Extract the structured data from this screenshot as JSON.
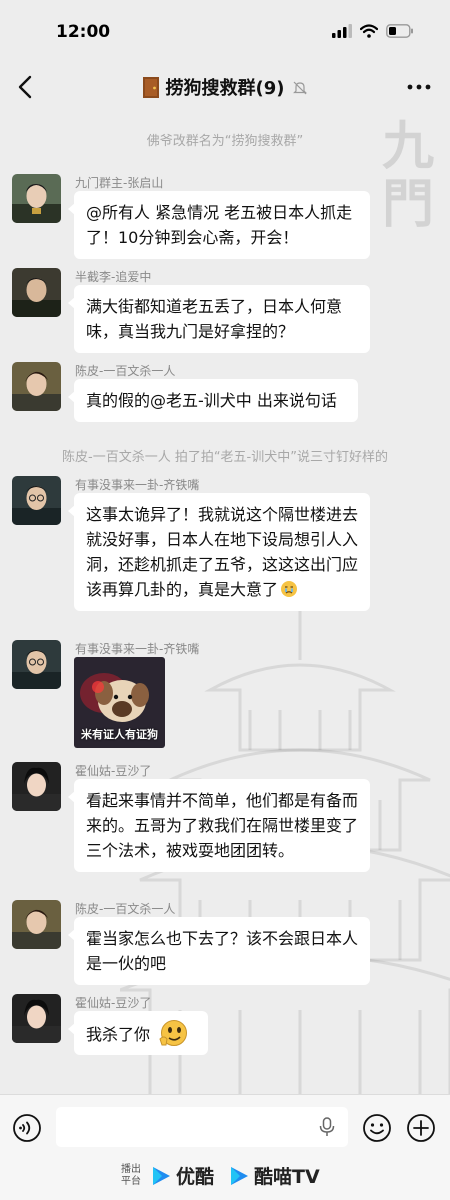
{
  "status": {
    "time": "12:00"
  },
  "header": {
    "title": "捞狗搜救群(9)"
  },
  "system_messages": [
    "佛爷改群名为“捞狗搜救群”",
    "陈皮-一百文杀一人 拍了拍“老五-训犬中”说三寸钉好样的"
  ],
  "messages": [
    {
      "sender": "九门群主-张启山",
      "text": "@所有人 紧急情况 老五被日本人抓走了！10分钟到会心斋，开会！"
    },
    {
      "sender": "半截李-追爱中",
      "text": "满大街都知道老五丢了，日本人何意味，真当我九门是好拿捏的？"
    },
    {
      "sender": "陈皮-一百文杀一人",
      "text": "真的假的@老五-训犬中 出来说句话"
    },
    {
      "sender": "有事没事来一卦-齐铁嘴",
      "text": "这事太诡异了！我就说这个隔世楼进去就没好事，日本人在地下设局想引人入洞，还趁机抓走了五爷，这这这出门应该再算几卦的，真是大意了"
    },
    {
      "sender": "有事没事来一卦-齐铁嘴",
      "image_caption": "米有证人有证狗"
    },
    {
      "sender": "霍仙姑-豆沙了",
      "text": "看起来事情并不简单，他们都是有备而来的。五哥为了救我们在隔世楼里变了三个法术，被戏耍地团团转。"
    },
    {
      "sender": "陈皮-一百文杀一人",
      "text": "霍当家怎么也下去了？该不会跟日本人是一伙的吧"
    },
    {
      "sender": "霍仙姑-豆沙了",
      "text": "我杀了你"
    }
  ],
  "footer": {
    "label": "播出平台",
    "brand1": "优酷",
    "brand2": "酷喵TV"
  },
  "colors": {
    "background": "#ededed",
    "bubble": "#ffffff",
    "youku_blue": "#1f8cf0",
    "system_text": "#a8a8a8"
  }
}
